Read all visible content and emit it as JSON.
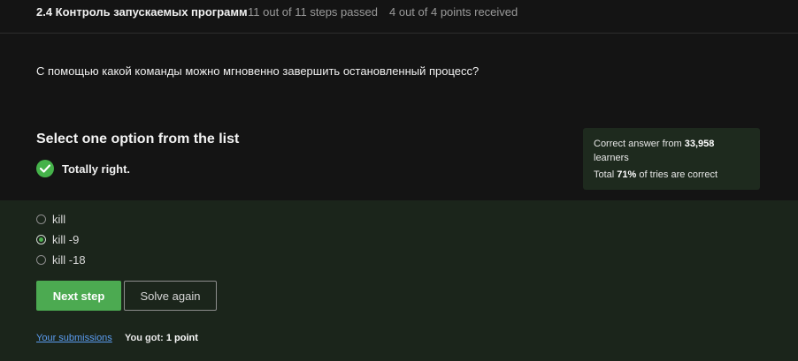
{
  "header": {
    "lesson_title": "2.4 Контроль запускаемых программ",
    "steps_stat": "11 out of 11 steps passed",
    "points_stat": "4 out of 4 points  received"
  },
  "question": {
    "text": "С помощью какой команды можно мгновенно завершить остановленный процесс?"
  },
  "quiz": {
    "title": "Select one option from the list",
    "feedback": "Totally right.",
    "options": [
      {
        "label": "kill",
        "selected": false
      },
      {
        "label": "kill -9",
        "selected": true
      },
      {
        "label": "kill -18",
        "selected": false
      }
    ]
  },
  "stats": {
    "correct_prefix": "Correct answer from ",
    "learners_count": "33,958",
    "learners_suffix": " learners",
    "total_prefix": "Total ",
    "total_percent": "71%",
    "total_suffix": " of tries are correct"
  },
  "buttons": {
    "next_step": "Next step",
    "solve_again": "Solve again"
  },
  "footer": {
    "submissions_link": "Your submissions",
    "score_prefix": "You got: ",
    "score_value": "1 point"
  },
  "colors": {
    "background": "#141414",
    "answer_panel": "#1b251b",
    "stats_box": "#1e2a1e",
    "accent_green": "#4caa51",
    "link_blue": "#5b9cf0"
  },
  "icons": {
    "feedback_icon": "check-circle-icon"
  }
}
